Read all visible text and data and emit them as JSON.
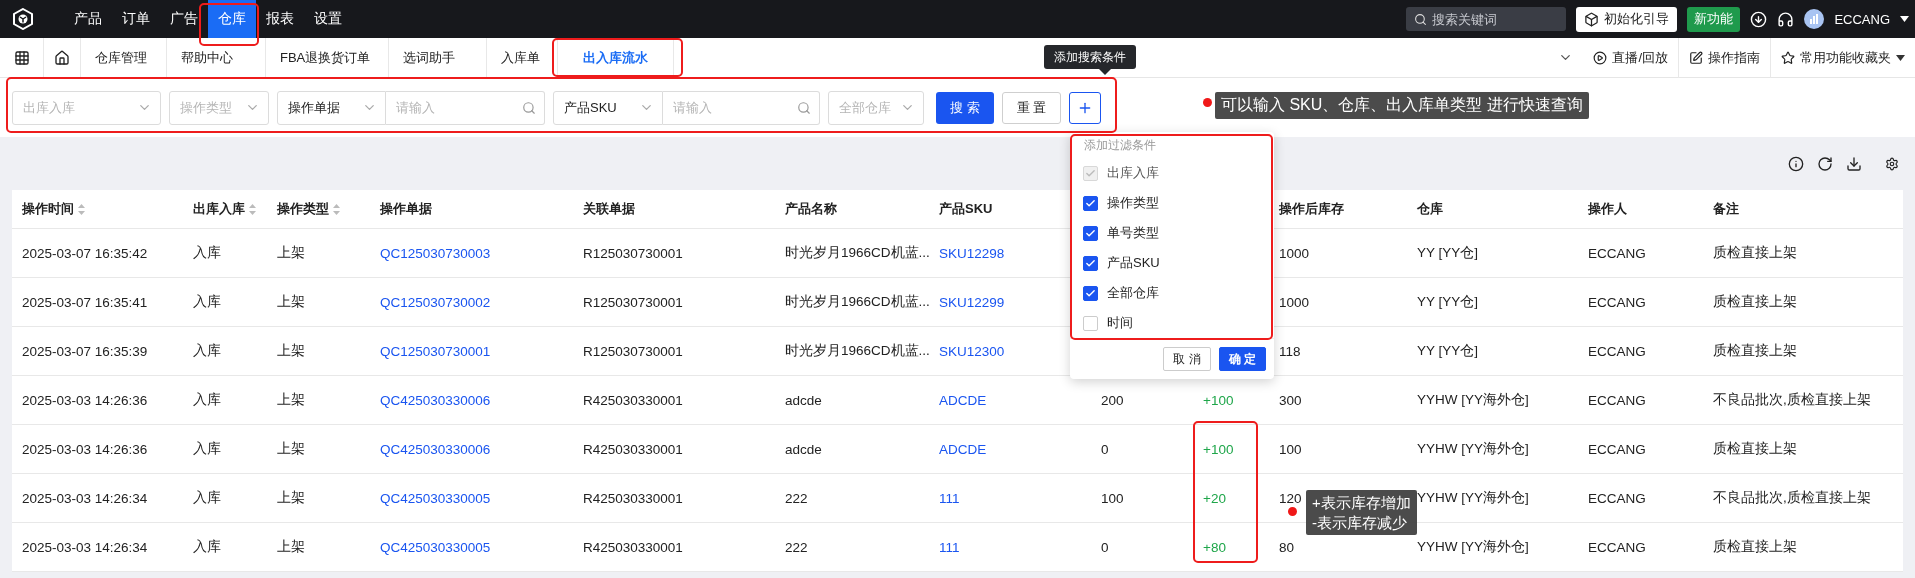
{
  "top_nav": {
    "items": [
      {
        "label": "产品",
        "selected": false
      },
      {
        "label": "订单",
        "selected": false
      },
      {
        "label": "广告",
        "selected": false
      },
      {
        "label": "仓库",
        "selected": true
      },
      {
        "label": "报表",
        "selected": false
      },
      {
        "label": "设置",
        "selected": false
      }
    ],
    "search": {
      "placeholder": "搜索关键词"
    },
    "guide_button": "初始化引导",
    "new_feature_button": "新功能",
    "user": "ECCANG"
  },
  "tabs": {
    "items": [
      {
        "label": "仓库管理",
        "selected": false
      },
      {
        "label": "帮助中心",
        "selected": false
      },
      {
        "label": "FBA退换货订单",
        "selected": false
      },
      {
        "label": "选词助手",
        "selected": false
      },
      {
        "label": "入库单",
        "selected": false
      },
      {
        "label": "出入库流水",
        "selected": true
      }
    ],
    "live": "直播/回放",
    "guide": "操作指南",
    "favorites": "常用功能收藏夹"
  },
  "filters": [
    {
      "kind": "select",
      "placeholder": "出库入库"
    },
    {
      "kind": "select",
      "placeholder": "操作类型"
    },
    {
      "kind": "select",
      "value": "操作单据"
    },
    {
      "kind": "input",
      "placeholder": "请输入"
    },
    {
      "kind": "select",
      "value": "产品SKU"
    },
    {
      "kind": "input",
      "placeholder": "请输入"
    },
    {
      "kind": "select",
      "placeholder": "全部仓库"
    }
  ],
  "buttons": {
    "search": "搜 索",
    "reset": "重 置"
  },
  "add_tooltip": "添加搜索条件",
  "filter_popover": {
    "title": "添加过滤条件",
    "options": [
      {
        "label": "出库入库",
        "checked": true,
        "disabled": true
      },
      {
        "label": "操作类型",
        "checked": true,
        "disabled": false
      },
      {
        "label": "单号类型",
        "checked": true,
        "disabled": false
      },
      {
        "label": "产品SKU",
        "checked": true,
        "disabled": false
      },
      {
        "label": "全部仓库",
        "checked": true,
        "disabled": false
      },
      {
        "label": "时间",
        "checked": false,
        "disabled": false
      }
    ],
    "cancel": "取 消",
    "confirm": "确 定"
  },
  "table": {
    "columns": [
      {
        "label": "操作时间",
        "sortable": true,
        "kind": "text"
      },
      {
        "label": "出库入库",
        "sortable": true,
        "kind": "text"
      },
      {
        "label": "操作类型",
        "sortable": true,
        "kind": "text"
      },
      {
        "label": "操作单据",
        "sortable": false,
        "kind": "link"
      },
      {
        "label": "关联单据",
        "sortable": false,
        "kind": "text"
      },
      {
        "label": "产品名称",
        "sortable": false,
        "kind": "text"
      },
      {
        "label": "产品SKU",
        "sortable": false,
        "kind": "link"
      },
      {
        "kind": "text"
      },
      {
        "kind": "change"
      },
      {
        "label": "操作后库存",
        "sortable": false,
        "kind": "text"
      },
      {
        "label": "仓库",
        "sortable": false,
        "kind": "text"
      },
      {
        "label": "操作人",
        "sortable": false,
        "kind": "text"
      },
      {
        "label": "备注",
        "sortable": false,
        "kind": "text"
      }
    ],
    "rows": [
      [
        "2025-03-07 16:35:42",
        "入库",
        "上架",
        "QC125030730003",
        "R125030730001",
        "时光岁月1966CD机蓝...",
        "SKU12298",
        null,
        null,
        "1000",
        "YY [YY仓]",
        "ECCANG",
        "质检直接上架"
      ],
      [
        "2025-03-07 16:35:41",
        "入库",
        "上架",
        "QC125030730002",
        "R125030730001",
        "时光岁月1966CD机蓝...",
        "SKU12299",
        null,
        null,
        "1000",
        "YY [YY仓]",
        "ECCANG",
        "质检直接上架"
      ],
      [
        "2025-03-07 16:35:39",
        "入库",
        "上架",
        "QC125030730001",
        "R125030730001",
        "时光岁月1966CD机蓝...",
        "SKU12300",
        null,
        null,
        "118",
        "YY [YY仓]",
        "ECCANG",
        "质检直接上架"
      ],
      [
        "2025-03-03 14:26:36",
        "入库",
        "上架",
        "QC425030330006",
        "R425030330001",
        "adcde",
        "ADCDE",
        "200",
        "+100",
        "300",
        "YYHW [YY海外仓]",
        "ECCANG",
        "不良品批次,质检直接上架"
      ],
      [
        "2025-03-03 14:26:36",
        "入库",
        "上架",
        "QC425030330006",
        "R425030330001",
        "adcde",
        "ADCDE",
        "0",
        "+100",
        "100",
        "YYHW [YY海外仓]",
        "ECCANG",
        "质检直接上架"
      ],
      [
        "2025-03-03 14:26:34",
        "入库",
        "上架",
        "QC425030330005",
        "R425030330001",
        "222",
        "111",
        "100",
        "+20",
        "120",
        "YYHW [YY海外仓]",
        "ECCANG",
        "不良品批次,质检直接上架"
      ],
      [
        "2025-03-03 14:26:34",
        "入库",
        "上架",
        "QC425030330005",
        "R425030330001",
        "222",
        "111",
        "0",
        "+80",
        "80",
        "YYHW [YY海外仓]",
        "ECCANG",
        "质检直接上架"
      ]
    ]
  },
  "callouts": [
    {
      "lines": [
        "可以输入 SKU、仓库、出入库单类型 进行快速查询"
      ]
    },
    {
      "lines": [
        "+表示库存增加",
        "-表示库存减少"
      ]
    }
  ]
}
